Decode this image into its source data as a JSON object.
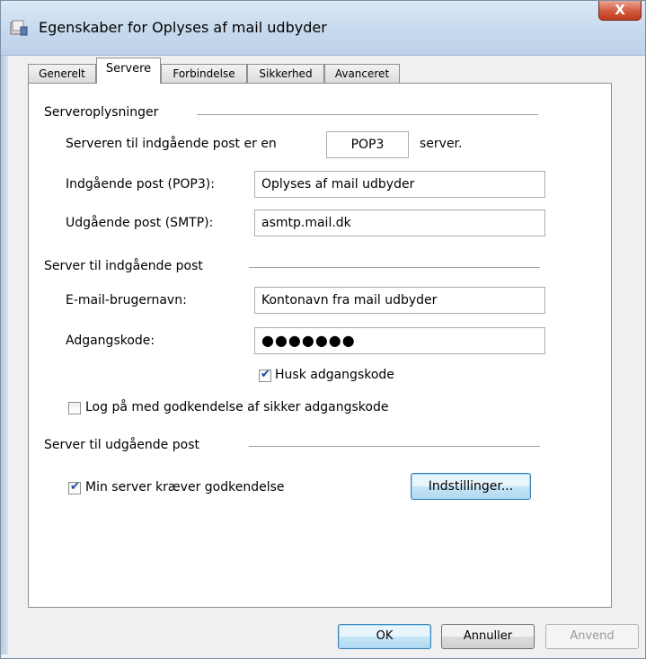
{
  "window": {
    "title": "Egenskaber for Oplyses af mail udbyder",
    "close_glyph": "X"
  },
  "tabs": [
    {
      "label": "Generelt"
    },
    {
      "label": "Servere"
    },
    {
      "label": "Forbindelse"
    },
    {
      "label": "Sikkerhed"
    },
    {
      "label": "Avanceret"
    }
  ],
  "server_info": {
    "heading": "Serveroplysninger",
    "type_label": "Serveren til indgående post er en",
    "type_value": "POP3",
    "type_suffix": "server.",
    "incoming_label": "Indgående post (POP3):",
    "incoming_value": "Oplyses af mail udbyder",
    "outgoing_label": "Udgående post (SMTP):",
    "outgoing_value": "asmtp.mail.dk"
  },
  "incoming_server": {
    "heading": "Server til indgående post",
    "username_label": "E-mail-brugernavn:",
    "username_value": "Kontonavn fra mail udbyder",
    "password_label": "Adgangskode:",
    "password_value": "●●●●●●●",
    "remember_label": "Husk adgangskode",
    "remember_checked": true,
    "spa_label": "Log på med godkendelse af sikker adgangskode",
    "spa_checked": false
  },
  "outgoing_server": {
    "heading": "Server til udgående post",
    "auth_label": "Min server kræver godkendelse",
    "auth_checked": true,
    "settings_button": "Indstillinger..."
  },
  "buttons": {
    "ok": "OK",
    "cancel": "Annuller",
    "apply": "Anvend"
  },
  "check_glyph": "✔"
}
